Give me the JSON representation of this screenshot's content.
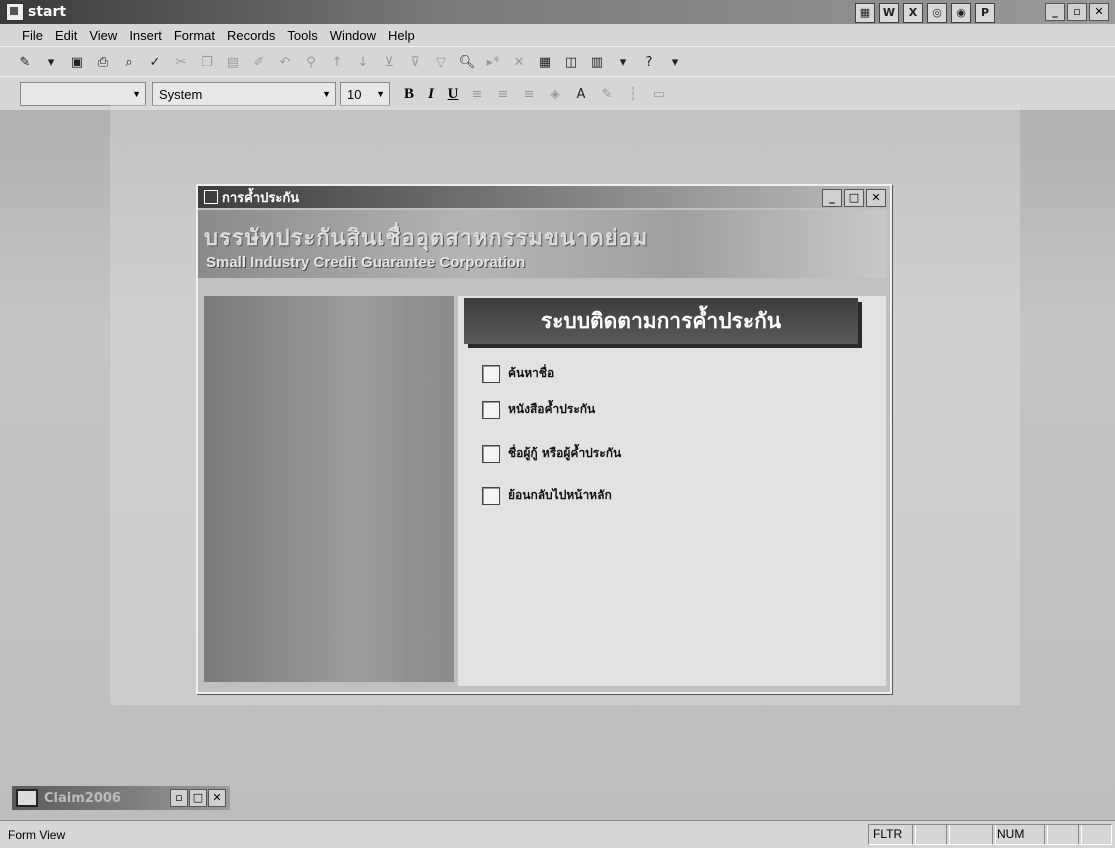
{
  "window": {
    "title": "start"
  },
  "menu": [
    "File",
    "Edit",
    "View",
    "Insert",
    "Format",
    "Records",
    "Tools",
    "Window",
    "Help"
  ],
  "format_toolbar": {
    "font_name": "System",
    "font_size": "10",
    "bold": "B",
    "italic": "I",
    "underline": "U"
  },
  "form": {
    "title": "การค้ำประกัน",
    "banner_thai": "บรรษัทประกันสินเชื่ออุตสาหกรรมขนาดย่อม",
    "banner_english": "Small Industry Credit Guarantee Corporation",
    "header": "ระบบติดตามการค้ำประกัน",
    "options": [
      {
        "label": "ค้นหาชื่อ"
      },
      {
        "label": "หนังสือค้ำประกัน"
      },
      {
        "label": "ชื่อผู้กู้ หรือผู้ค้ำประกัน"
      },
      {
        "label": "ย้อนกลับไปหน้าหลัก"
      }
    ]
  },
  "minimized_window": {
    "title": "Claim2006"
  },
  "status": {
    "mode": "Form View",
    "filter": "FLTR",
    "num": "NUM"
  }
}
